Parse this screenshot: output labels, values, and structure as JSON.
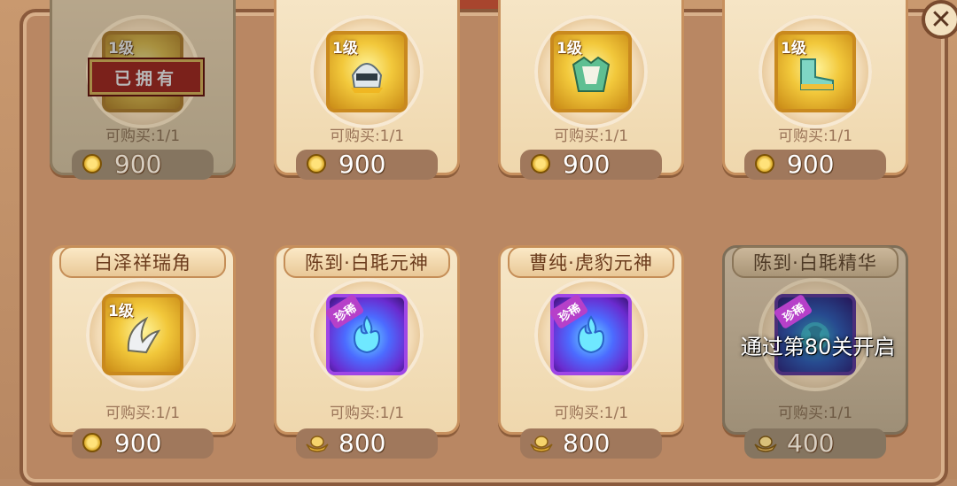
{
  "ui": {
    "close_glyph": "✕"
  },
  "items": [
    {
      "name": "",
      "level": "1级",
      "rare": "",
      "owned_label": "已拥有",
      "limit": "可购买:1/1",
      "currency": "coin-icon",
      "price": "900",
      "state": "owned",
      "icon_style": "gold"
    },
    {
      "name": "",
      "level": "1级",
      "rare": "",
      "owned_label": "",
      "limit": "可购买:1/1",
      "currency": "coin-icon",
      "price": "900",
      "state": "normal",
      "icon_style": "gold"
    },
    {
      "name": "",
      "level": "1级",
      "rare": "",
      "owned_label": "",
      "limit": "可购买:1/1",
      "currency": "coin-icon",
      "price": "900",
      "state": "normal",
      "icon_style": "gold"
    },
    {
      "name": "",
      "level": "1级",
      "rare": "",
      "owned_label": "",
      "limit": "可购买:1/1",
      "currency": "coin-icon",
      "price": "900",
      "state": "normal",
      "icon_style": "gold"
    },
    {
      "name": "白泽祥瑞角",
      "level": "1级",
      "rare": "",
      "owned_label": "",
      "limit": "可购买:1/1",
      "currency": "coin-icon",
      "price": "900",
      "state": "normal",
      "icon_style": "gold"
    },
    {
      "name": "陈到·白毦元神",
      "level": "",
      "rare": "珍稀",
      "owned_label": "",
      "limit": "可购买:1/1",
      "currency": "ingot-icon",
      "price": "800",
      "state": "normal",
      "icon_style": "purple"
    },
    {
      "name": "曹纯·虎豹元神",
      "level": "",
      "rare": "珍稀",
      "owned_label": "",
      "limit": "可购买:1/1",
      "currency": "ingot-icon",
      "price": "800",
      "state": "normal",
      "icon_style": "purple"
    },
    {
      "name": "陈到·白毦精华",
      "level": "",
      "rare": "珍稀",
      "owned_label": "",
      "limit": "可购买:1/1",
      "currency": "ingot-icon",
      "price": "400",
      "state": "locked",
      "icon_style": "dark",
      "lock_text": "通过第80关开启"
    }
  ],
  "colors": {
    "panel": "#b98763",
    "card": "#f6e6c7",
    "price_bar": "#a0785c",
    "owned_stamp": "#c4281c",
    "rare_tag": "#b640c9"
  }
}
